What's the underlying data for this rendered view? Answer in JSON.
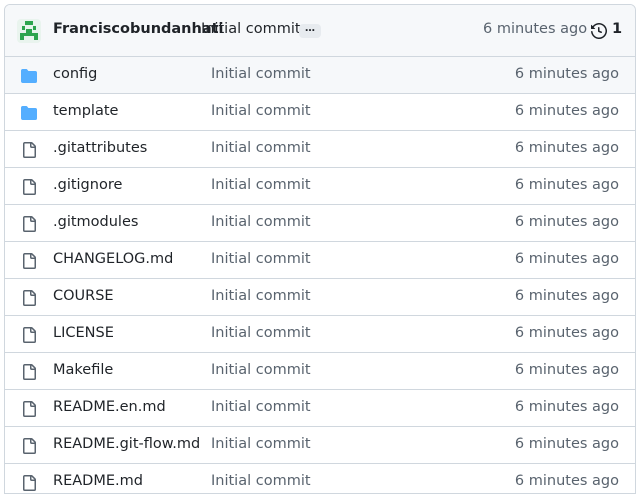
{
  "header": {
    "author": "Franciscobundanhati",
    "message": "Initial commit",
    "ellipsis": "…",
    "time": "6 minutes ago",
    "history_count": "1"
  },
  "files": [
    {
      "name": "config",
      "type": "folder",
      "message": "Initial commit",
      "time": "6 minutes ago"
    },
    {
      "name": "template",
      "type": "folder",
      "message": "Initial commit",
      "time": "6 minutes ago"
    },
    {
      "name": ".gitattributes",
      "type": "file",
      "message": "Initial commit",
      "time": "6 minutes ago"
    },
    {
      "name": ".gitignore",
      "type": "file",
      "message": "Initial commit",
      "time": "6 minutes ago"
    },
    {
      "name": ".gitmodules",
      "type": "file",
      "message": "Initial commit",
      "time": "6 minutes ago"
    },
    {
      "name": "CHANGELOG.md",
      "type": "file",
      "message": "Initial commit",
      "time": "6 minutes ago"
    },
    {
      "name": "COURSE",
      "type": "file",
      "message": "Initial commit",
      "time": "6 minutes ago"
    },
    {
      "name": "LICENSE",
      "type": "file",
      "message": "Initial commit",
      "time": "6 minutes ago"
    },
    {
      "name": "Makefile",
      "type": "file",
      "message": "Initial commit",
      "time": "6 minutes ago"
    },
    {
      "name": "README.en.md",
      "type": "file",
      "message": "Initial commit",
      "time": "6 minutes ago"
    },
    {
      "name": "README.git-flow.md",
      "type": "file",
      "message": "Initial commit",
      "time": "6 minutes ago"
    },
    {
      "name": "README.md",
      "type": "file",
      "message": "Initial commit",
      "time": "6 minutes ago"
    }
  ],
  "colors": {
    "folder": "#54aeff",
    "file_icon": "#59636e",
    "border": "#d0d7de",
    "header_bg": "#f6f8fa",
    "avatar_green": "#2da44e"
  },
  "icons": {
    "folder": "folder-icon",
    "file": "file-icon",
    "history": "history-icon"
  }
}
